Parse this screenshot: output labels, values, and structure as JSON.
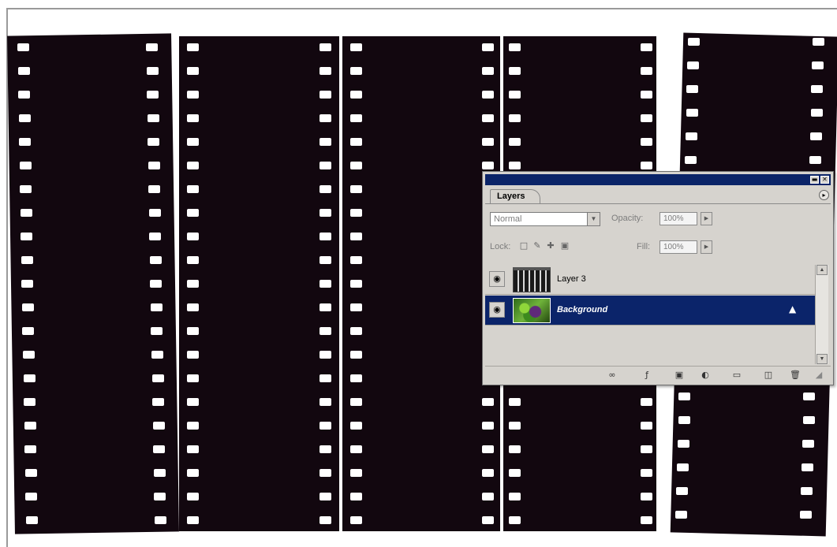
{
  "layers_panel": {
    "tab_label": "Layers",
    "blend_mode": "Normal",
    "opacity_label": "Opacity:",
    "opacity_value": "100%",
    "lock_label": "Lock:",
    "fill_label": "Fill:",
    "fill_value": "100%",
    "layers": [
      {
        "name": "Layer 3",
        "selected": false,
        "visible": true
      },
      {
        "name": "Background",
        "selected": true,
        "visible": true,
        "locked": true
      }
    ]
  },
  "colors": {
    "selected_row": "#0b246a",
    "title_bar": "#0b2468",
    "panel_bg": "#d6d3ce",
    "film": "#12070f"
  },
  "icons": {
    "title_bar": [
      "minimize-icon",
      "close-icon"
    ],
    "lock": [
      "lock-transparent-icon",
      "lock-paint-icon",
      "lock-move-icon",
      "lock-all-icon"
    ],
    "bottom_bar": [
      "link-icon",
      "layer-style-icon",
      "mask-icon",
      "adjustment-icon",
      "group-icon",
      "new-layer-icon",
      "trash-icon"
    ]
  }
}
